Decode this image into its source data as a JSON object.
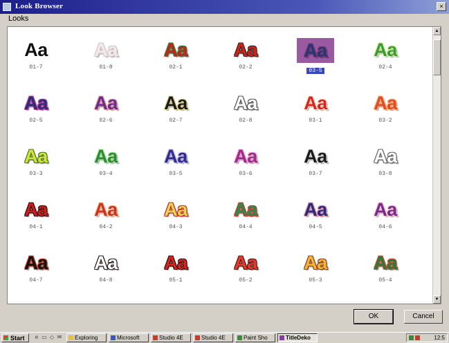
{
  "window": {
    "title": "Look Browser",
    "close_glyph": "×"
  },
  "menu": {
    "looks_label": "Looks"
  },
  "looks": [
    {
      "label": "01-7",
      "color": "#111111",
      "outline": ""
    },
    {
      "label": "01-8",
      "color": "#f2eaea",
      "outline": "#d8c8cc"
    },
    {
      "label": "02-1",
      "color": "#c8201a",
      "outline": "#2a8a3a"
    },
    {
      "label": "02-2",
      "color": "#d02418",
      "outline": "#2b2b2b"
    },
    {
      "label": "03-5",
      "color": "#2a3570",
      "outline": "#7a3a80",
      "selected": true
    },
    {
      "label": "02-4",
      "color": "#3c9a3c",
      "outline": "#d7ef9a"
    },
    {
      "label": "02-5",
      "color": "#2a2e7a",
      "outline": "#b53a96"
    },
    {
      "label": "02-6",
      "color": "#6a2c8a",
      "outline": "#e7a0a8"
    },
    {
      "label": "02-7",
      "color": "#1a1a1a",
      "outline": "#e6d890"
    },
    {
      "label": "02-8",
      "color": "#ffffff",
      "outline": "#555555"
    },
    {
      "label": "03-1",
      "color": "#d8261e",
      "outline": "#ffe0d0"
    },
    {
      "label": "03-2",
      "color": "#e04c24",
      "outline": "#f3b57e"
    },
    {
      "label": "03-3",
      "color": "#d6e23a",
      "outline": "#3f7a2a"
    },
    {
      "label": "03-4",
      "color": "#2e8a3a",
      "outline": "#b6e6a0"
    },
    {
      "label": "03-5",
      "color": "#2e2e88",
      "outline": "#c6b8e8"
    },
    {
      "label": "03-6",
      "color": "#a02a8a",
      "outline": "#e6b0d8"
    },
    {
      "label": "03-7",
      "color": "#1a1a1a",
      "outline": "#dddddd"
    },
    {
      "label": "03-8",
      "color": "#ffffff",
      "outline": "#666666"
    },
    {
      "label": "04-1",
      "color": "#c8201e",
      "outline": "#3a0a0a"
    },
    {
      "label": "04-2",
      "color": "#c8341c",
      "outline": "#f4c6a8"
    },
    {
      "label": "04-3",
      "color": "#e8d45a",
      "outline": "#c22a1e"
    },
    {
      "label": "04-4",
      "color": "#2c8a4a",
      "outline": "#c63a2c"
    },
    {
      "label": "04-5",
      "color": "#2a2a7a",
      "outline": "#e69ab0"
    },
    {
      "label": "04-6",
      "color": "#7a2a8a",
      "outline": "#f4c8d0"
    },
    {
      "label": "04-7",
      "color": "#111111",
      "outline": "#c63a2c"
    },
    {
      "label": "04-8",
      "color": "#ffffff",
      "outline": "#2a1a1a"
    },
    {
      "label": "05-1",
      "color": "#d8261e",
      "outline": "#2a0e0e"
    },
    {
      "label": "05-2",
      "color": "#e83a2a",
      "outline": "#4a1e1a"
    },
    {
      "label": "05-3",
      "color": "#f0b83a",
      "outline": "#9a3a1a"
    },
    {
      "label": "05-4",
      "color": "#2c7a3a",
      "outline": "#c64a2e"
    }
  ],
  "buttons": {
    "ok": "OK",
    "cancel": "Cancel"
  },
  "taskbar": {
    "start": "Start",
    "tasks": [
      {
        "label": "Exploring",
        "icon": "folder-icon",
        "color": "#e8c040"
      },
      {
        "label": "Microsoft",
        "icon": "word-icon",
        "color": "#3a5ab8"
      },
      {
        "label": "Studio 4E",
        "icon": "studio-icon",
        "color": "#c83a2a"
      },
      {
        "label": "Studio 4E",
        "icon": "studio-icon",
        "color": "#c83a2a"
      },
      {
        "label": "Paint Sho",
        "icon": "paint-icon",
        "color": "#3a8a3a"
      },
      {
        "label": "TitleDeko",
        "icon": "titledeko-icon",
        "color": "#8a3aa8",
        "active": true
      }
    ],
    "clock": "12:5"
  }
}
